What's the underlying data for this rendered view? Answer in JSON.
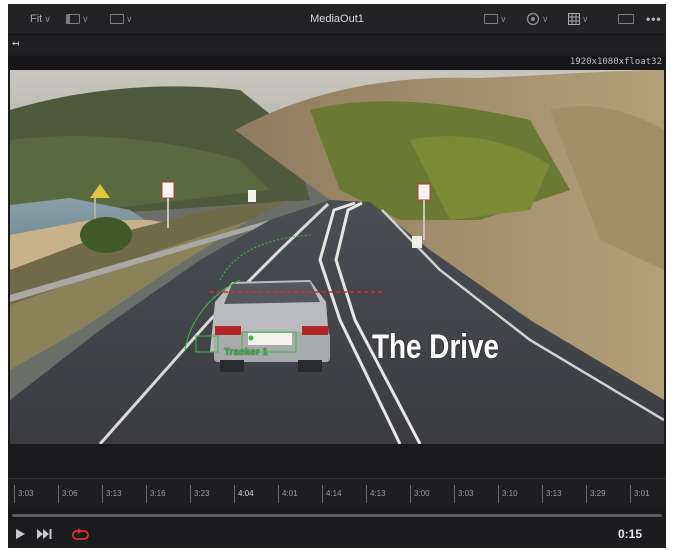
{
  "toolbar": {
    "fit_label": "Fit",
    "title": "MediaOut1",
    "more_label": "•••"
  },
  "viewer": {
    "resolution": "1920x1080xfloat32",
    "overlay_title": "The Drive",
    "tracker_label": "Tracker 1"
  },
  "ruler": {
    "ticks": [
      "3:03",
      "3:06",
      "3:13",
      "3:16",
      "3:23",
      "4:04",
      "4:01",
      "4:14",
      "4:13",
      "3:00",
      "3:03",
      "3:10",
      "3:13",
      "3:29",
      "3:01"
    ]
  },
  "transport": {
    "timecode": "0:15",
    "play_icon": "play-icon",
    "skip_icon": "skip-forward-icon",
    "loop_icon": "loop-icon"
  },
  "colors": {
    "loop_active": "#d8312a",
    "tracker_green": "#3cb84a"
  }
}
